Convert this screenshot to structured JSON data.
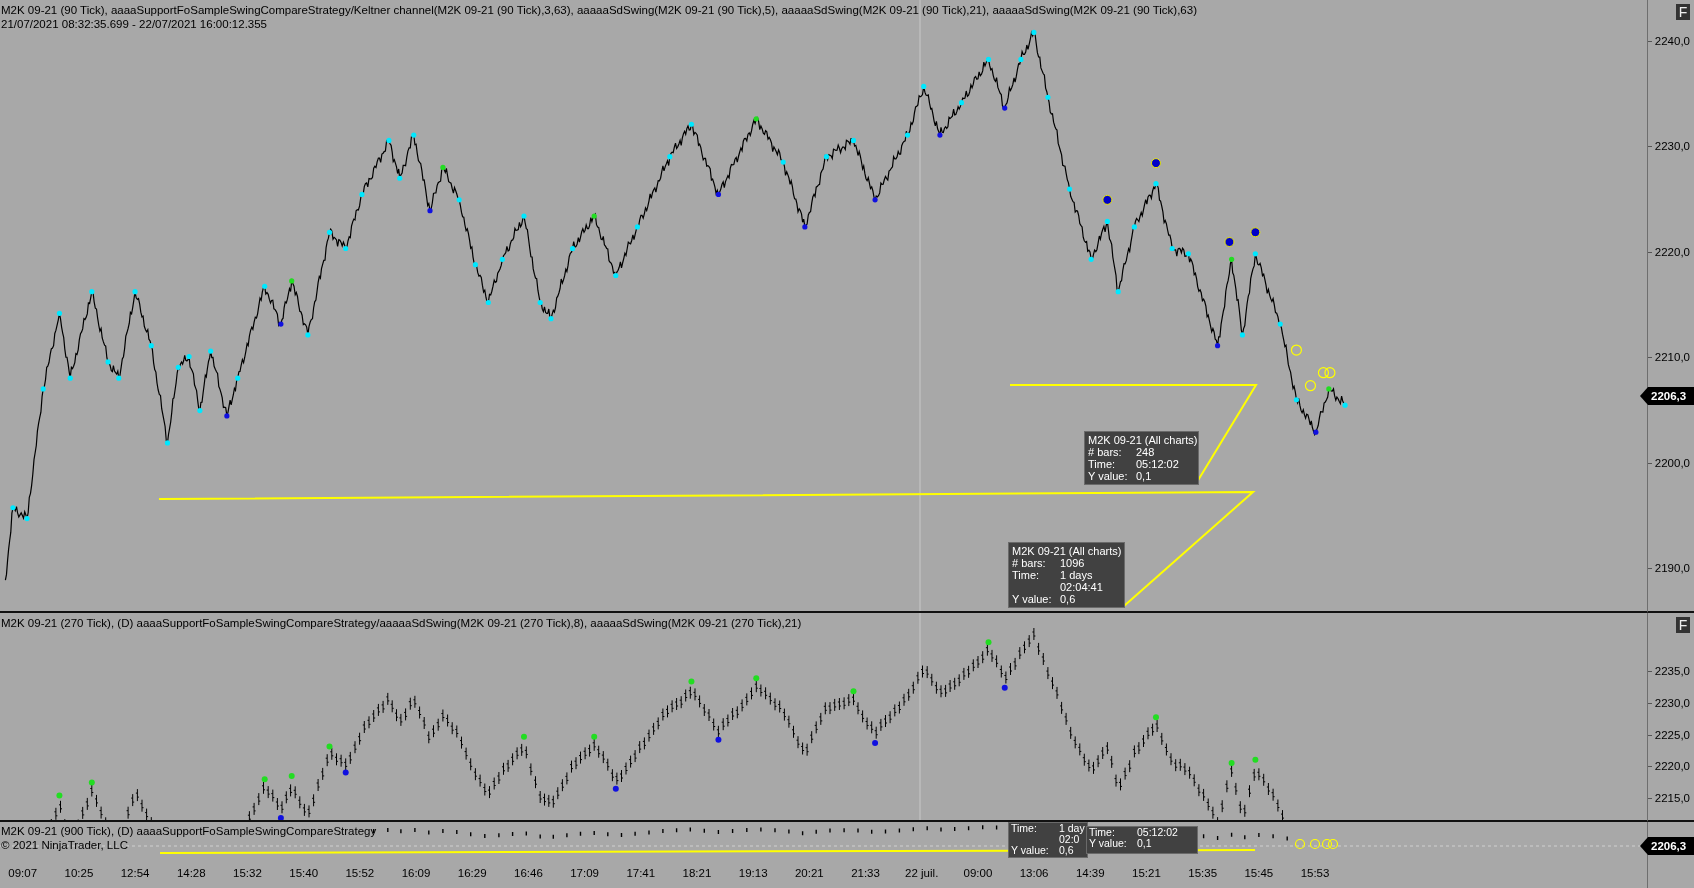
{
  "top_panel": {
    "title": "M2K 09-21 (90 Tick), aaaaSupportFoSampleSwingCompareStrategy/Keltner channel(M2K 09-21 (90 Tick),3,63), aaaaaSdSwing(M2K 09-21 (90 Tick),5), aaaaaSdSwing(M2K 09-21 (90 Tick),21), aaaaaSdSwing(M2K 09-21 (90 Tick),63)",
    "date_range": "21/07/2021 08:32:35.699 - 22/07/2021 16:00:12.355",
    "panel_button": "F",
    "price_ticks": [
      "2240,0",
      "2230,0",
      "2220,0",
      "2210,0",
      "2200,0",
      "2190,0"
    ],
    "last_price": "2206,3",
    "tooltips": [
      {
        "title": "M2K 09-21 (All charts)",
        "rows": [
          {
            "label": "# bars:",
            "value": "248"
          },
          {
            "label": "Time:",
            "value": "05:12:02"
          },
          {
            "label": "Y value:",
            "value": "0,1"
          }
        ]
      },
      {
        "title": "M2K 09-21 (All charts)",
        "rows": [
          {
            "label": "# bars:",
            "value": "1096"
          },
          {
            "label": "Time:",
            "value": "1 days"
          },
          {
            "value": "02:04:41"
          },
          {
            "label": "Y value:",
            "value": "0,6"
          }
        ]
      }
    ]
  },
  "middle_panel": {
    "title": "M2K 09-21 (270 Tick), (D) aaaaSupportFoSampleSwingCompareStrategy/aaaaaSdSwing(M2K 09-21 (270 Tick),8), aaaaaSdSwing(M2K 09-21 (270 Tick),21)",
    "panel_button": "F",
    "price_ticks": [
      "2235,0",
      "2230,0",
      "2225,0",
      "2220,0",
      "2215,0"
    ]
  },
  "bottom_panel": {
    "title": "M2K 09-21 (900 Tick), (D) aaaaSupportFoSampleSwingCompareStrategy",
    "copyright": "© 2021 NinjaTrader, LLC",
    "last_price": "2206,3",
    "tooltips": [
      {
        "rows": [
          {
            "label": "Time:",
            "value": "1 day"
          },
          {
            "value": "02:0"
          },
          {
            "label": "Y value:",
            "value": "0,6"
          }
        ]
      },
      {
        "rows": [
          {
            "label": "Time:",
            "value": "05:12:02"
          },
          {
            "label": "Y value:",
            "value": "0,1"
          }
        ]
      }
    ]
  },
  "time_axis": [
    "09:07",
    "10:25",
    "12:54",
    "14:28",
    "15:32",
    "15:40",
    "15:52",
    "16:09",
    "16:29",
    "16:46",
    "17:09",
    "17:41",
    "18:21",
    "19:13",
    "20:21",
    "21:33",
    "22 juil.",
    "09:00",
    "13:06",
    "14:39",
    "15:21",
    "15:35",
    "15:45",
    "15:53"
  ]
}
